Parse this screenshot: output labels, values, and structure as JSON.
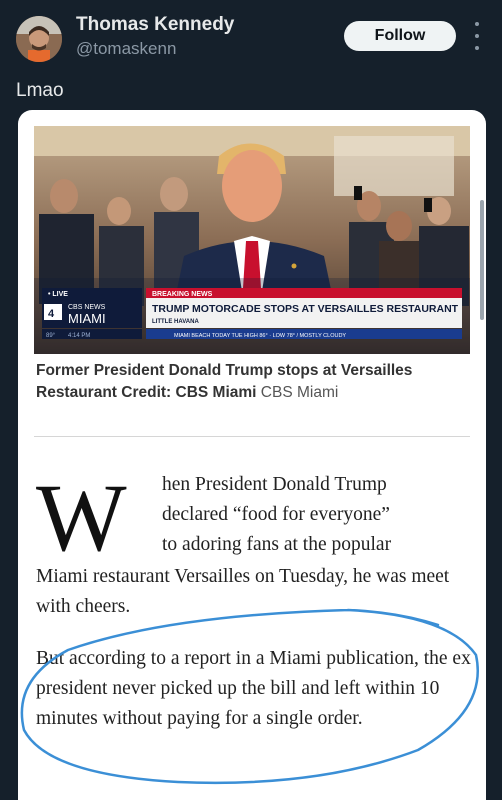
{
  "tweet": {
    "author_name": "Thomas Kennedy",
    "author_handle": "@tomaskenn",
    "follow_label": "Follow",
    "text": "Lmao"
  },
  "news_image": {
    "live_label": "• LIVE",
    "channel_number": "4",
    "cbs_news": "CBS NEWS",
    "city": "MIAMI",
    "breaking_label": "BREAKING NEWS",
    "headline": "TRUMP MOTORCADE STOPS AT VERSAILLES RESTAURANT",
    "location": "LITTLE HAVANA",
    "temp": "89°",
    "time": "4:14 PM",
    "ticker": "MIAMI BEACH TODAY TUE HIGH 86° · LOW 78° / MOSTLY CLOUDY"
  },
  "caption": {
    "bold_text": "Former President Donald Trump stops at Versailles Restaurant Credit: CBS Miami",
    "credit": "CBS Miami"
  },
  "article": {
    "dropcap": "W",
    "p1_lines": [
      "hen President Donald Trump",
      "declared “food for everyone”",
      "to adoring fans at the popular"
    ],
    "p1_rest": "Miami restaurant Versailles on Tuesday, he was meet with cheers.",
    "p2": "But according to a report in a Miami publication, the ex president never picked up the bill and left within 10 minutes without paying for a single order."
  },
  "colors": {
    "background": "#15202b",
    "breaking_red": "#c8102e",
    "annotation_blue": "#3b8fd6"
  }
}
